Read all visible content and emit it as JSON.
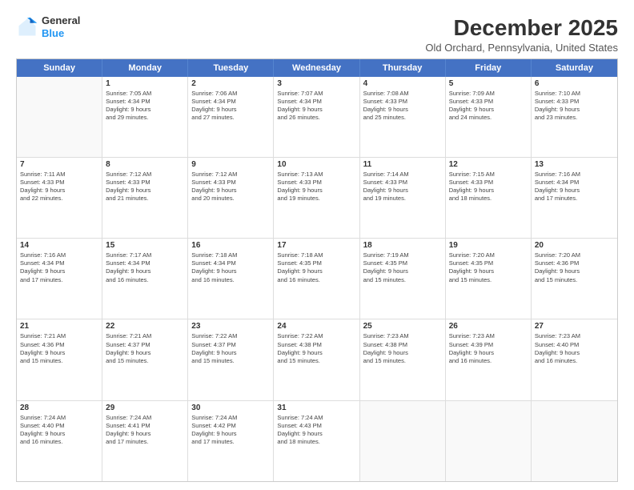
{
  "logo": {
    "general": "General",
    "blue": "Blue"
  },
  "title": "December 2025",
  "subtitle": "Old Orchard, Pennsylvania, United States",
  "header_days": [
    "Sunday",
    "Monday",
    "Tuesday",
    "Wednesday",
    "Thursday",
    "Friday",
    "Saturday"
  ],
  "weeks": [
    [
      {
        "day": "",
        "info": ""
      },
      {
        "day": "1",
        "info": "Sunrise: 7:05 AM\nSunset: 4:34 PM\nDaylight: 9 hours\nand 29 minutes."
      },
      {
        "day": "2",
        "info": "Sunrise: 7:06 AM\nSunset: 4:34 PM\nDaylight: 9 hours\nand 27 minutes."
      },
      {
        "day": "3",
        "info": "Sunrise: 7:07 AM\nSunset: 4:34 PM\nDaylight: 9 hours\nand 26 minutes."
      },
      {
        "day": "4",
        "info": "Sunrise: 7:08 AM\nSunset: 4:33 PM\nDaylight: 9 hours\nand 25 minutes."
      },
      {
        "day": "5",
        "info": "Sunrise: 7:09 AM\nSunset: 4:33 PM\nDaylight: 9 hours\nand 24 minutes."
      },
      {
        "day": "6",
        "info": "Sunrise: 7:10 AM\nSunset: 4:33 PM\nDaylight: 9 hours\nand 23 minutes."
      }
    ],
    [
      {
        "day": "7",
        "info": "Sunrise: 7:11 AM\nSunset: 4:33 PM\nDaylight: 9 hours\nand 22 minutes."
      },
      {
        "day": "8",
        "info": "Sunrise: 7:12 AM\nSunset: 4:33 PM\nDaylight: 9 hours\nand 21 minutes."
      },
      {
        "day": "9",
        "info": "Sunrise: 7:12 AM\nSunset: 4:33 PM\nDaylight: 9 hours\nand 20 minutes."
      },
      {
        "day": "10",
        "info": "Sunrise: 7:13 AM\nSunset: 4:33 PM\nDaylight: 9 hours\nand 19 minutes."
      },
      {
        "day": "11",
        "info": "Sunrise: 7:14 AM\nSunset: 4:33 PM\nDaylight: 9 hours\nand 19 minutes."
      },
      {
        "day": "12",
        "info": "Sunrise: 7:15 AM\nSunset: 4:33 PM\nDaylight: 9 hours\nand 18 minutes."
      },
      {
        "day": "13",
        "info": "Sunrise: 7:16 AM\nSunset: 4:34 PM\nDaylight: 9 hours\nand 17 minutes."
      }
    ],
    [
      {
        "day": "14",
        "info": "Sunrise: 7:16 AM\nSunset: 4:34 PM\nDaylight: 9 hours\nand 17 minutes."
      },
      {
        "day": "15",
        "info": "Sunrise: 7:17 AM\nSunset: 4:34 PM\nDaylight: 9 hours\nand 16 minutes."
      },
      {
        "day": "16",
        "info": "Sunrise: 7:18 AM\nSunset: 4:34 PM\nDaylight: 9 hours\nand 16 minutes."
      },
      {
        "day": "17",
        "info": "Sunrise: 7:18 AM\nSunset: 4:35 PM\nDaylight: 9 hours\nand 16 minutes."
      },
      {
        "day": "18",
        "info": "Sunrise: 7:19 AM\nSunset: 4:35 PM\nDaylight: 9 hours\nand 15 minutes."
      },
      {
        "day": "19",
        "info": "Sunrise: 7:20 AM\nSunset: 4:35 PM\nDaylight: 9 hours\nand 15 minutes."
      },
      {
        "day": "20",
        "info": "Sunrise: 7:20 AM\nSunset: 4:36 PM\nDaylight: 9 hours\nand 15 minutes."
      }
    ],
    [
      {
        "day": "21",
        "info": "Sunrise: 7:21 AM\nSunset: 4:36 PM\nDaylight: 9 hours\nand 15 minutes."
      },
      {
        "day": "22",
        "info": "Sunrise: 7:21 AM\nSunset: 4:37 PM\nDaylight: 9 hours\nand 15 minutes."
      },
      {
        "day": "23",
        "info": "Sunrise: 7:22 AM\nSunset: 4:37 PM\nDaylight: 9 hours\nand 15 minutes."
      },
      {
        "day": "24",
        "info": "Sunrise: 7:22 AM\nSunset: 4:38 PM\nDaylight: 9 hours\nand 15 minutes."
      },
      {
        "day": "25",
        "info": "Sunrise: 7:23 AM\nSunset: 4:38 PM\nDaylight: 9 hours\nand 15 minutes."
      },
      {
        "day": "26",
        "info": "Sunrise: 7:23 AM\nSunset: 4:39 PM\nDaylight: 9 hours\nand 16 minutes."
      },
      {
        "day": "27",
        "info": "Sunrise: 7:23 AM\nSunset: 4:40 PM\nDaylight: 9 hours\nand 16 minutes."
      }
    ],
    [
      {
        "day": "28",
        "info": "Sunrise: 7:24 AM\nSunset: 4:40 PM\nDaylight: 9 hours\nand 16 minutes."
      },
      {
        "day": "29",
        "info": "Sunrise: 7:24 AM\nSunset: 4:41 PM\nDaylight: 9 hours\nand 17 minutes."
      },
      {
        "day": "30",
        "info": "Sunrise: 7:24 AM\nSunset: 4:42 PM\nDaylight: 9 hours\nand 17 minutes."
      },
      {
        "day": "31",
        "info": "Sunrise: 7:24 AM\nSunset: 4:43 PM\nDaylight: 9 hours\nand 18 minutes."
      },
      {
        "day": "",
        "info": ""
      },
      {
        "day": "",
        "info": ""
      },
      {
        "day": "",
        "info": ""
      }
    ]
  ]
}
